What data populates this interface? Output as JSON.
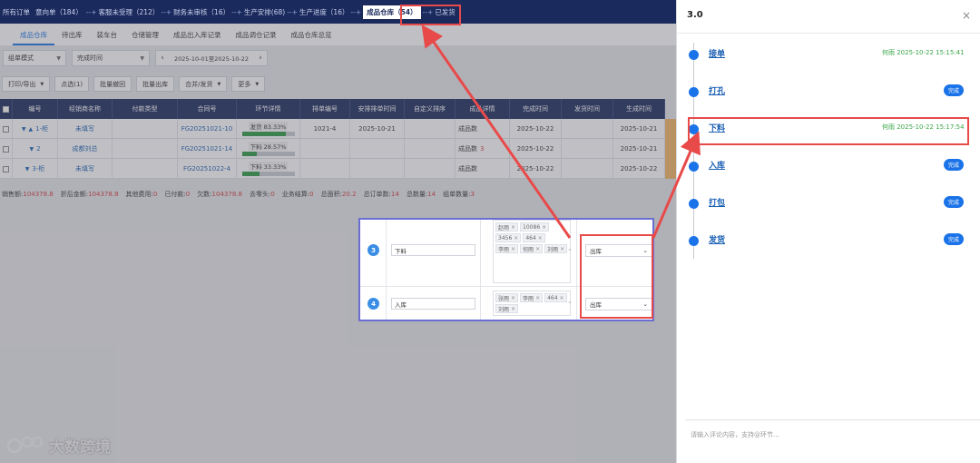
{
  "flow": [
    {
      "label": "所有订单",
      "arrow": ""
    },
    {
      "label": "意向单（184）",
      "arrow": ""
    },
    {
      "label": "客服未受理（212）",
      "arrow": "--+"
    },
    {
      "label": "财务未审核（16）",
      "arrow": "--+"
    },
    {
      "label": "生产安排(68)",
      "arrow": "--+"
    },
    {
      "label": "生产进度（16）",
      "arrow": "--+"
    },
    {
      "label": "成品仓库（54）",
      "arrow": "--+",
      "active": true
    },
    {
      "label": "已发货",
      "arrow": "--+"
    }
  ],
  "tabs": [
    "成品仓库",
    "待出库",
    "装车台",
    "仓储管理",
    "成品出入库记录",
    "成品调仓记录",
    "成品仓库总览"
  ],
  "filters": {
    "mode": "组单模式",
    "time_field": "完成时间",
    "date_range": "2025-10-01至2025-10-22"
  },
  "actions": [
    "打印/导出",
    "点选(1)",
    "批量撤回",
    "批量出库",
    "合并/发货",
    "更多"
  ],
  "table": {
    "headers": [
      "编号",
      "经销商名称",
      "付款类型",
      "合同号",
      "环节详情",
      "排单编号",
      "安排排单时间",
      "自定义排序",
      "成品详情",
      "完成时间",
      "发货时间",
      "生成时间"
    ],
    "rows": [
      {
        "id": "1-柜",
        "dealer": "未填写",
        "pay": "",
        "contract": "FG20251021-10",
        "stage": "发货 83.33%",
        "progress": 0.8333,
        "sched_no": "1021-4",
        "sched_time": "2025-10-21",
        "custom": "",
        "detail": "成品数",
        "detail_num": "",
        "done": "2025-10-22",
        "ship": "",
        "created": "2025-10-21"
      },
      {
        "id": "2",
        "dealer": "成都刘总",
        "pay": "",
        "contract": "FG20251021-14",
        "stage": "下料 28.57%",
        "progress": 0.2857,
        "sched_no": "",
        "sched_time": "",
        "custom": "",
        "detail": "成品数",
        "detail_num": "3",
        "done": "2025-10-22",
        "ship": "",
        "created": "2025-10-21"
      },
      {
        "id": "3-柜",
        "dealer": "未填写",
        "pay": "",
        "contract": "FG20251022-4",
        "stage": "下料 33.33%",
        "progress": 0.3333,
        "sched_no": "",
        "sched_time": "",
        "custom": "",
        "detail": "成品数",
        "detail_num": "",
        "done": "2025-10-22",
        "ship": "",
        "created": "2025-10-22"
      }
    ]
  },
  "summary": [
    {
      "label": "销售额:",
      "value": "104378.8"
    },
    {
      "label": "折后金额:",
      "value": "104378.8"
    },
    {
      "label": "其他费用:",
      "value": "0"
    },
    {
      "label": "已付款:",
      "value": "0"
    },
    {
      "label": "欠数:",
      "value": "104378.8"
    },
    {
      "label": "去零头:",
      "value": "0"
    },
    {
      "label": "业务结算:",
      "value": "0"
    },
    {
      "label": "总面积:",
      "value": "20.2"
    },
    {
      "label": "总订单数:",
      "value": "14"
    },
    {
      "label": "总数量:",
      "value": "14"
    },
    {
      "label": "组单数量:",
      "value": "3"
    }
  ],
  "overlay": {
    "rows": [
      {
        "num": "3",
        "name": "下料",
        "tags": [
          "赵雨",
          "10086",
          "3456",
          "464",
          "李雨",
          "何雨",
          "刘雨"
        ],
        "select": "出库"
      },
      {
        "num": "4",
        "name": "入库",
        "tags": [
          "张雨",
          "李雨",
          "464",
          "刘雨"
        ],
        "select": "出库"
      }
    ]
  },
  "watermark": "大数跨境",
  "panel": {
    "title": "3.0",
    "steps": [
      {
        "name": "接单",
        "meta": "何雨 2025-10-22 15:15:41",
        "badge": ""
      },
      {
        "name": "打孔",
        "meta": "",
        "badge": "完成"
      },
      {
        "name": "下料",
        "meta": "何雨 2025-10-22 15:17:54",
        "badge": ""
      },
      {
        "name": "入库",
        "meta": "",
        "badge": "完成"
      },
      {
        "name": "打包",
        "meta": "",
        "badge": "完成"
      },
      {
        "name": "发货",
        "meta": "",
        "badge": "完成"
      }
    ],
    "comment_placeholder": "请输入评论内容，支持@环节..."
  },
  "colors": {
    "nav": "#1b2a5c",
    "accent": "#1a73e8",
    "highlight": "#e84a4a",
    "progress": "#2e9a44",
    "meta_green": "#3aa84a"
  }
}
